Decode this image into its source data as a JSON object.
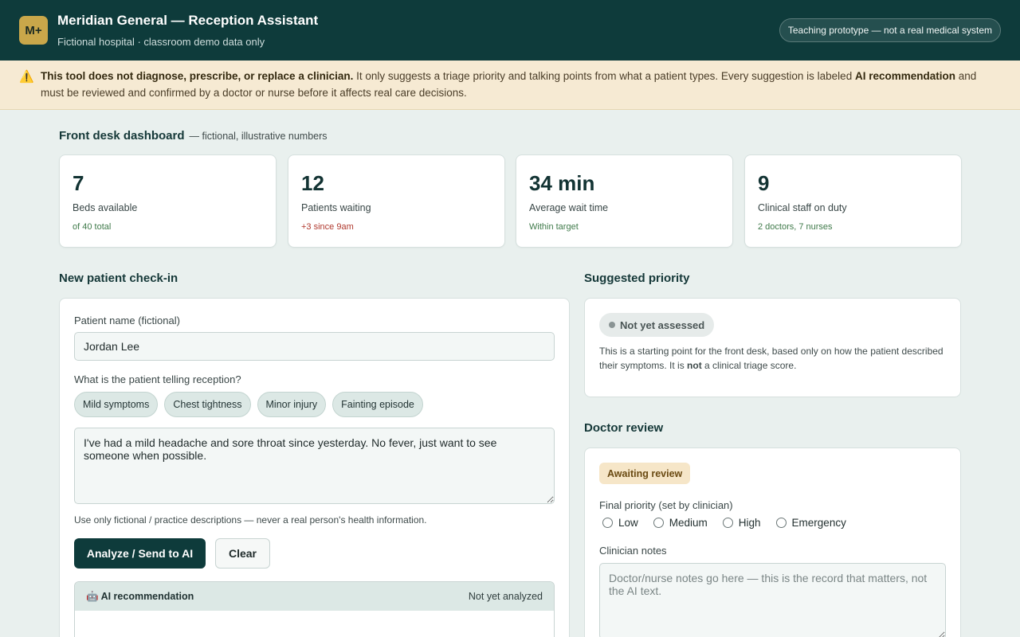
{
  "header": {
    "logo": "M+",
    "title": "Meridian General — Reception Assistant",
    "subtitle": "Fictional hospital · classroom demo data only",
    "badge": "Teaching prototype — not a real medical system"
  },
  "warning": {
    "icon": "⚠️",
    "bold_lead": "This tool does not diagnose, prescribe, or replace a clinician.",
    "text_1": " It only suggests a triage priority and talking points from what a patient types. Every suggestion is labeled ",
    "bold_mid": "AI recommendation",
    "text_2": " and must be reviewed and confirmed by a doctor or nurse before it affects real care decisions."
  },
  "dashboard": {
    "title": "Front desk dashboard",
    "note": "— fictional, illustrative numbers",
    "stats": [
      {
        "value": "7",
        "label": "Beds available",
        "sub": "of 40 total",
        "sub_color": "#3f7a4a"
      },
      {
        "value": "12",
        "label": "Patients waiting",
        "sub": "+3 since 9am",
        "sub_color": "#b0392e"
      },
      {
        "value": "34 min",
        "label": "Average wait time",
        "sub": "Within target",
        "sub_color": "#3f7a4a"
      },
      {
        "value": "9",
        "label": "Clinical staff on duty",
        "sub": "2 doctors, 7 nurses",
        "sub_color": "#3f7a4a"
      }
    ]
  },
  "checkin": {
    "title": "New patient check-in",
    "name_label": "Patient name (fictional)",
    "name_value": "Jordan Lee",
    "symptoms_label": "What is the patient telling reception?",
    "chips": [
      "Mild symptoms",
      "Chest tightness",
      "Minor injury",
      "Fainting episode"
    ],
    "description": "I've had a mild headache and sore throat since yesterday. No fever, just want to see someone when possible.",
    "help": "Use only fictional / practice descriptions — never a real person's health information.",
    "analyze_button": "Analyze / Send to AI",
    "clear_button": "Clear",
    "ai_title": "🤖 AI recommendation",
    "ai_status": "Not yet analyzed"
  },
  "priority": {
    "title": "Suggested priority",
    "badge": "Not yet assessed",
    "desc_1": "This is a starting point for the front desk, based only on how the patient described their symptoms. It is ",
    "desc_bold": "not",
    "desc_2": " a clinical triage score."
  },
  "review": {
    "title": "Doctor review",
    "badge": "Awaiting review",
    "final_label": "Final priority (set by clinician)",
    "options": [
      "Low",
      "Medium",
      "High",
      "Emergency"
    ],
    "notes_label": "Clinician notes",
    "notes_placeholder": "Doctor/nurse notes go here — this is the record that matters, not the AI text."
  }
}
